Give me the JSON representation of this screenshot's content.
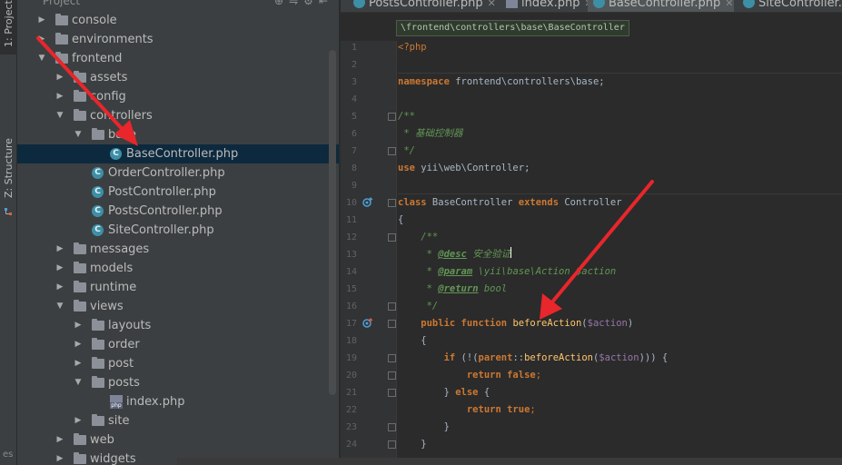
{
  "sidebar_tabs": {
    "project": "1: Project",
    "structure": "Z: Structure"
  },
  "strip_bottom": "es",
  "project_panel": {
    "title": "Project",
    "tree": [
      {
        "label": "console",
        "kind": "folder",
        "state": "collapsed",
        "depth": 0
      },
      {
        "label": "environments",
        "kind": "folder",
        "state": "collapsed",
        "depth": 0
      },
      {
        "label": "frontend",
        "kind": "folder",
        "state": "expanded",
        "depth": 0
      },
      {
        "label": "assets",
        "kind": "folder",
        "state": "collapsed",
        "depth": 1
      },
      {
        "label": "config",
        "kind": "folder",
        "state": "collapsed",
        "depth": 1
      },
      {
        "label": "controllers",
        "kind": "folder",
        "state": "expanded",
        "depth": 1
      },
      {
        "label": "base",
        "kind": "folder",
        "state": "expanded",
        "depth": 2
      },
      {
        "label": "BaseController.php",
        "kind": "php-class",
        "state": "leaf",
        "depth": 3,
        "selected": true
      },
      {
        "label": "OrderController.php",
        "kind": "php-class",
        "state": "leaf",
        "depth": 2
      },
      {
        "label": "PostController.php",
        "kind": "php-class",
        "state": "leaf",
        "depth": 2
      },
      {
        "label": "PostsController.php",
        "kind": "php-class",
        "state": "leaf",
        "depth": 2
      },
      {
        "label": "SiteController.php",
        "kind": "php-class",
        "state": "leaf",
        "depth": 2
      },
      {
        "label": "messages",
        "kind": "folder",
        "state": "collapsed",
        "depth": 1
      },
      {
        "label": "models",
        "kind": "folder",
        "state": "collapsed",
        "depth": 1
      },
      {
        "label": "runtime",
        "kind": "folder",
        "state": "collapsed",
        "depth": 1
      },
      {
        "label": "views",
        "kind": "folder",
        "state": "expanded",
        "depth": 1
      },
      {
        "label": "layouts",
        "kind": "folder",
        "state": "collapsed",
        "depth": 2
      },
      {
        "label": "order",
        "kind": "folder",
        "state": "collapsed",
        "depth": 2
      },
      {
        "label": "post",
        "kind": "folder",
        "state": "collapsed",
        "depth": 2
      },
      {
        "label": "posts",
        "kind": "folder",
        "state": "expanded",
        "depth": 2
      },
      {
        "label": "index.php",
        "kind": "php-file",
        "state": "leaf",
        "depth": 3
      },
      {
        "label": "site",
        "kind": "folder",
        "state": "collapsed",
        "depth": 2
      },
      {
        "label": "web",
        "kind": "folder",
        "state": "collapsed",
        "depth": 1
      },
      {
        "label": "widgets",
        "kind": "folder",
        "state": "collapsed",
        "depth": 1
      }
    ]
  },
  "tabs": [
    {
      "label": "PostsController.php",
      "icon": "php-class-icon",
      "active": false
    },
    {
      "label": "index.php",
      "icon": "php-file-icon",
      "active": false
    },
    {
      "label": "BaseController.php",
      "icon": "php-class-icon",
      "active": true
    },
    {
      "label": "SiteController.php",
      "icon": "php-class-icon",
      "active": false
    }
  ],
  "breadcrumb": "\\frontend\\controllers\\base\\BaseController",
  "editor": {
    "line_numbers": [
      "1",
      "2",
      "3",
      "4",
      "5",
      "6",
      "7",
      "8",
      "9",
      "10",
      "11",
      "12",
      "13",
      "14",
      "15",
      "16",
      "17",
      "18",
      "19",
      "20",
      "21",
      "22",
      "23",
      "24"
    ],
    "lines": [
      [
        {
          "t": "<?php",
          "c": "kn"
        }
      ],
      [],
      [
        {
          "t": "namespace",
          "c": "k"
        },
        {
          "t": " frontend\\controllers\\base;",
          "c": "cn"
        }
      ],
      [],
      [
        {
          "t": "/**",
          "c": "doc"
        }
      ],
      [
        {
          "t": " * 基础控制器",
          "c": "doc"
        }
      ],
      [
        {
          "t": " */",
          "c": "doc"
        }
      ],
      [
        {
          "t": "use",
          "c": "k"
        },
        {
          "t": " yii\\web\\Controller;",
          "c": "cn"
        }
      ],
      [],
      [
        {
          "t": "class",
          "c": "k"
        },
        {
          "t": " BaseController ",
          "c": "cn"
        },
        {
          "t": "extends",
          "c": "k"
        },
        {
          "t": " Controller",
          "c": "cn"
        }
      ],
      [
        {
          "t": "{",
          "c": "cn"
        }
      ],
      [
        {
          "t": "    /**",
          "c": "doc"
        }
      ],
      [
        {
          "t": "     * ",
          "c": "doc"
        },
        {
          "t": "@desc",
          "c": "doctag"
        },
        {
          "t": " 安全验证",
          "c": "doc"
        }
      ],
      [
        {
          "t": "     * ",
          "c": "doc"
        },
        {
          "t": "@param",
          "c": "doctag"
        },
        {
          "t": " \\yii\\base\\Action $action",
          "c": "doc"
        }
      ],
      [
        {
          "t": "     * ",
          "c": "doc"
        },
        {
          "t": "@return",
          "c": "doctag"
        },
        {
          "t": " bool",
          "c": "doc"
        }
      ],
      [
        {
          "t": "     */",
          "c": "doc"
        }
      ],
      [
        {
          "t": "    public function ",
          "c": "k"
        },
        {
          "t": "beforeAction",
          "c": "fn"
        },
        {
          "t": "(",
          "c": "cn"
        },
        {
          "t": "$action",
          "c": "var"
        },
        {
          "t": ")",
          "c": "cn"
        }
      ],
      [
        {
          "t": "    {",
          "c": "cn"
        }
      ],
      [
        {
          "t": "        if ",
          "c": "k"
        },
        {
          "t": "(!(",
          "c": "cn"
        },
        {
          "t": "parent",
          "c": "k"
        },
        {
          "t": "::",
          "c": "cn"
        },
        {
          "t": "beforeAction",
          "c": "fn"
        },
        {
          "t": "(",
          "c": "cn"
        },
        {
          "t": "$action",
          "c": "var"
        },
        {
          "t": "))) {",
          "c": "cn"
        }
      ],
      [
        {
          "t": "            return false",
          "c": "k"
        },
        {
          "t": ";",
          "c": "kn"
        }
      ],
      [
        {
          "t": "        } ",
          "c": "cn"
        },
        {
          "t": "else",
          "c": "k"
        },
        {
          "t": " {",
          "c": "cn"
        }
      ],
      [
        {
          "t": "            return true",
          "c": "k"
        },
        {
          "t": ";",
          "c": "kn"
        }
      ],
      [
        {
          "t": "        }",
          "c": "cn"
        }
      ],
      [
        {
          "t": "    }",
          "c": "cn"
        }
      ]
    ]
  },
  "colors": {
    "annotation_arrow": "#e8262b"
  }
}
